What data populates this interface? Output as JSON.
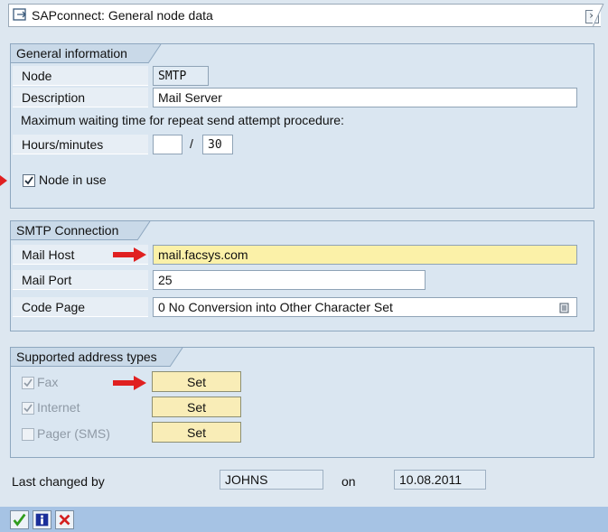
{
  "window": {
    "title": "SAPconnect: General node data",
    "close_symbol": "×"
  },
  "general": {
    "heading": "General information",
    "node_label": "Node",
    "node_value": "SMTP",
    "description_label": "Description",
    "description_value": "Mail Server",
    "waiting_text": "Maximum waiting time for repeat send attempt procedure:",
    "hours_label": "Hours/minutes",
    "hours_value": "",
    "slash": "/",
    "minutes_value": "30",
    "node_in_use_label": "Node in use",
    "node_in_use_checked": true
  },
  "smtp": {
    "heading": "SMTP Connection",
    "mail_host_label": "Mail Host",
    "mail_host_value": "mail.facsys.com",
    "mail_port_label": "Mail Port",
    "mail_port_value": "25",
    "code_page_label": "Code Page",
    "code_page_value": "0 No Conversion into Other Character Set"
  },
  "address_types": {
    "heading": "Supported address types",
    "items": [
      {
        "label": "Fax",
        "checked": true,
        "button": "Set"
      },
      {
        "label": "Internet",
        "checked": true,
        "button": "Set"
      },
      {
        "label": "Pager (SMS)",
        "checked": false,
        "button": "Set"
      }
    ]
  },
  "last_changed": {
    "label": "Last changed by",
    "user": "JOHNS",
    "on_label": "on",
    "date": "10.08.2011"
  },
  "colors": {
    "arrow": "#e02020",
    "highlight_field": "#fbf1a8",
    "button": "#f9edb7",
    "panel": "#dae6f1"
  },
  "icons": [
    "window-icon",
    "close-icon",
    "arrow-pointer-icon",
    "checkmark-icon",
    "info-icon",
    "cancel-icon",
    "f4-help-icon"
  ]
}
